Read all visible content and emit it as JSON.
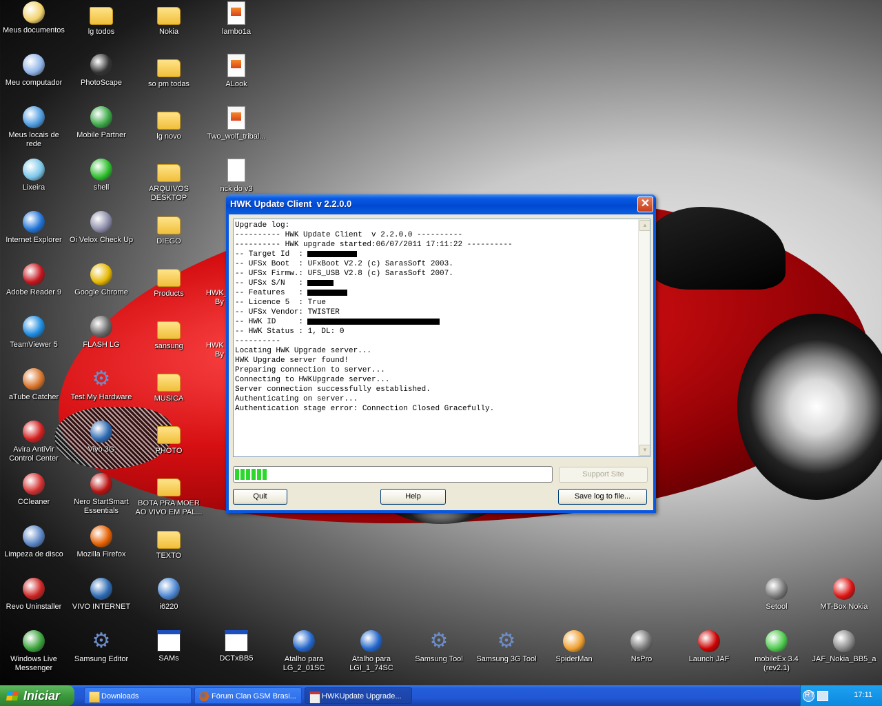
{
  "desktop": {
    "icons": [
      {
        "label": "Meus documentos",
        "icon": "my-documents-icon"
      },
      {
        "label": "lg todos",
        "icon": "folder-icon"
      },
      {
        "label": "Nokia",
        "icon": "folder-icon"
      },
      {
        "label": "lambo1a",
        "icon": "image-file-icon"
      },
      {
        "label": "Meu computador",
        "icon": "my-computer-icon"
      },
      {
        "label": "PhotoScape",
        "icon": "photoscape-icon"
      },
      {
        "label": "so pm todas",
        "icon": "folder-icon"
      },
      {
        "label": "ALook",
        "icon": "image-file-icon"
      },
      {
        "label": "Meus locais de rede",
        "icon": "network-icon"
      },
      {
        "label": "Mobile Partner",
        "icon": "mobile-partner-icon"
      },
      {
        "label": "lg novo",
        "icon": "folder-icon"
      },
      {
        "label": "Two_wolf_tribal...",
        "icon": "image-file-icon"
      },
      {
        "label": "Lixeira",
        "icon": "recycle-bin-icon"
      },
      {
        "label": "shell",
        "icon": "shell-icon"
      },
      {
        "label": "ARQUIVOS DESKTOP",
        "icon": "folder-icon"
      },
      {
        "label": "nck do v3",
        "icon": "text-file-icon"
      },
      {
        "label": "Internet Explorer",
        "icon": "internet-explorer-icon"
      },
      {
        "label": "Oi Velox Check Up",
        "icon": "oi-velox-icon"
      },
      {
        "label": "DIEGO",
        "icon": "folder-icon"
      },
      {
        "label": "Adobe Reader 9",
        "icon": "adobe-reader-icon"
      },
      {
        "label": "Google Chrome",
        "icon": "chrome-icon"
      },
      {
        "label": "Products",
        "icon": "folder-icon"
      },
      {
        "label": "TeamViewer 5",
        "icon": "teamviewer-icon"
      },
      {
        "label": "FLASH LG",
        "icon": "flash-lg-icon"
      },
      {
        "label": "sansung",
        "icon": "folder-icon"
      },
      {
        "label": "aTube Catcher",
        "icon": "atube-catcher-icon"
      },
      {
        "label": "Test My Hardware",
        "icon": "gear-icon"
      },
      {
        "label": "MUSICA",
        "icon": "folder-icon"
      },
      {
        "label": "Avira AntiVir Control Center",
        "icon": "avira-icon"
      },
      {
        "label": "Vivo 3G",
        "icon": "vivo-icon"
      },
      {
        "label": "PHOTO",
        "icon": "folder-icon"
      },
      {
        "label": "CCleaner",
        "icon": "ccleaner-icon"
      },
      {
        "label": "Nero StartSmart Essentials",
        "icon": "nero-icon"
      },
      {
        "label": "BOTA PRA MOER AO VIVO EM PAL...",
        "icon": "folder-icon"
      },
      {
        "label": "Limpeza de disco",
        "icon": "disk-cleanup-icon"
      },
      {
        "label": "Mozilla Firefox",
        "icon": "firefox-icon"
      },
      {
        "label": "TEXTO",
        "icon": "folder-icon"
      },
      {
        "label": "Revo Uninstaller",
        "icon": "revo-uninstaller-icon"
      },
      {
        "label": "VIVO INTERNET",
        "icon": "vivo-icon"
      },
      {
        "label": "i6220",
        "icon": "pencil-image-icon"
      },
      {
        "label": "Setool",
        "icon": "phone-icon"
      },
      {
        "label": "MT-Box Nokia",
        "icon": "mt-box-icon"
      },
      {
        "label": "Windows Live Messenger",
        "icon": "messenger-icon"
      },
      {
        "label": "Samsung Editor",
        "icon": "gear-icon"
      },
      {
        "label": "SAMs",
        "icon": "window-app-icon"
      },
      {
        "label": "DCTxBB5",
        "icon": "window-app-icon"
      },
      {
        "label": "Atalho para LG_2_01SC",
        "icon": "rocket-icon"
      },
      {
        "label": "Atalho para LGI_1_74SC",
        "icon": "rocket-icon"
      },
      {
        "label": "Samsung Tool",
        "icon": "gear-icon"
      },
      {
        "label": "Samsung 3G Tool",
        "icon": "gear-icon"
      },
      {
        "label": "SpiderMan",
        "icon": "house-icon"
      },
      {
        "label": "NsPro",
        "icon": "phone-icon"
      },
      {
        "label": "Launch JAF",
        "icon": "jaf-icon"
      },
      {
        "label": "mobileEx 3.4 (rev2.1)",
        "icon": "mobileex-icon"
      },
      {
        "label": "JAF_Nokia_BB5_a",
        "icon": "pen-icon"
      }
    ],
    "partial_labels": [
      "HWK_",
      "By",
      "HWK",
      "By"
    ]
  },
  "dialog": {
    "title": "HWK Update Client  v 2.2.0.0",
    "close_label": "✕",
    "log_lines": [
      "Upgrade log:",
      "---------- HWK Update Client  v 2.2.0.0 ----------",
      "---------- HWK upgrade started:06/07/2011 17:11:22 ----------",
      "-- Target Id  :",
      "-- UFSx Boot  : UFxBoot V2.2 (c) SarasSoft 2003.",
      "-- UFSx Firmw.: UFS_USB V2.8 (c) SarasSoft 2007.",
      "-- UFSx S/N   :",
      "-- Features   :",
      "-- Licence 5  : True",
      "-- UFSx Vendor: TWISTER",
      "-- HWK ID     :",
      "-- HWK Status : 1, DL: 0",
      "----------",
      "Locating HWK Upgrade server...",
      "HWK Upgrade server found!",
      "Preparing connection to server...",
      "Connecting to HWKUpgrade server...",
      "Server connection successfully established.",
      "Authenticating on server...",
      "Authentication stage error: Connection Closed Gracefully."
    ],
    "progress": 0.1,
    "buttons": {
      "support": "Support Site",
      "quit": "Quit",
      "help": "Help",
      "save_log": "Save log to file..."
    }
  },
  "taskbar": {
    "start_label": "Iniciar",
    "tasks": [
      {
        "label": "Downloads",
        "icon": "folder-icon"
      },
      {
        "label": "Fórum Clan GSM Brasi...",
        "icon": "firefox-icon"
      },
      {
        "label": "HWKUpdate Upgrade...",
        "icon": "hwk-app-icon"
      }
    ],
    "language": "PT",
    "clock": "17:11"
  }
}
